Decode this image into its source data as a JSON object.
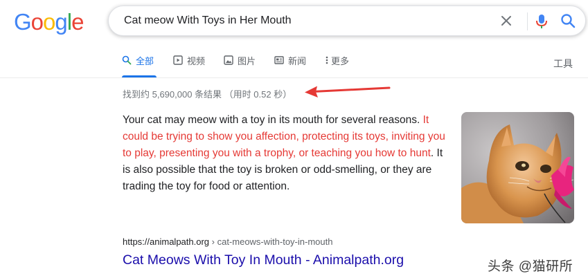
{
  "logo": {
    "letters": [
      "G",
      "o",
      "o",
      "g",
      "l",
      "e"
    ],
    "colors": [
      "#4285f4",
      "#ea4335",
      "#fbbc05",
      "#4285f4",
      "#34a853",
      "#ea4335"
    ]
  },
  "search": {
    "query": "Cat meow With Toys in Her Mouth"
  },
  "tabs": [
    {
      "label": "全部",
      "icon": "search-icon",
      "active": true
    },
    {
      "label": "视频",
      "icon": "video-icon",
      "active": false
    },
    {
      "label": "图片",
      "icon": "image-icon",
      "active": false
    },
    {
      "label": "新闻",
      "icon": "news-icon",
      "active": false
    },
    {
      "label": "更多",
      "icon": "more-icon",
      "active": false
    }
  ],
  "tools_label": "工具",
  "result_stats": "找到约 5,690,000 条结果 （用时 0.52 秒）",
  "annotation": {
    "arrow_color": "#e53935"
  },
  "snippet": {
    "part1": "Your cat may meow with a toy in its mouth for several reasons. ",
    "highlight": "It could be trying to show you affection, protecting its toys, inviting you to play, presenting you with a trophy, or teaching you how to hunt",
    "part2": ". It is also possible that the toy is broken or odd-smelling, or they are trading the toy for food or attention."
  },
  "result": {
    "url": "https://animalpath.org",
    "breadcrumb": " › cat-meows-with-toy-in-mouth",
    "title": "Cat Meows With Toy In Mouth - Animalpath.org"
  },
  "watermark": "头条 @猫研所",
  "colors": {
    "link": "#1a0dab",
    "accent": "#1a73e8",
    "highlight": "#e53935"
  }
}
